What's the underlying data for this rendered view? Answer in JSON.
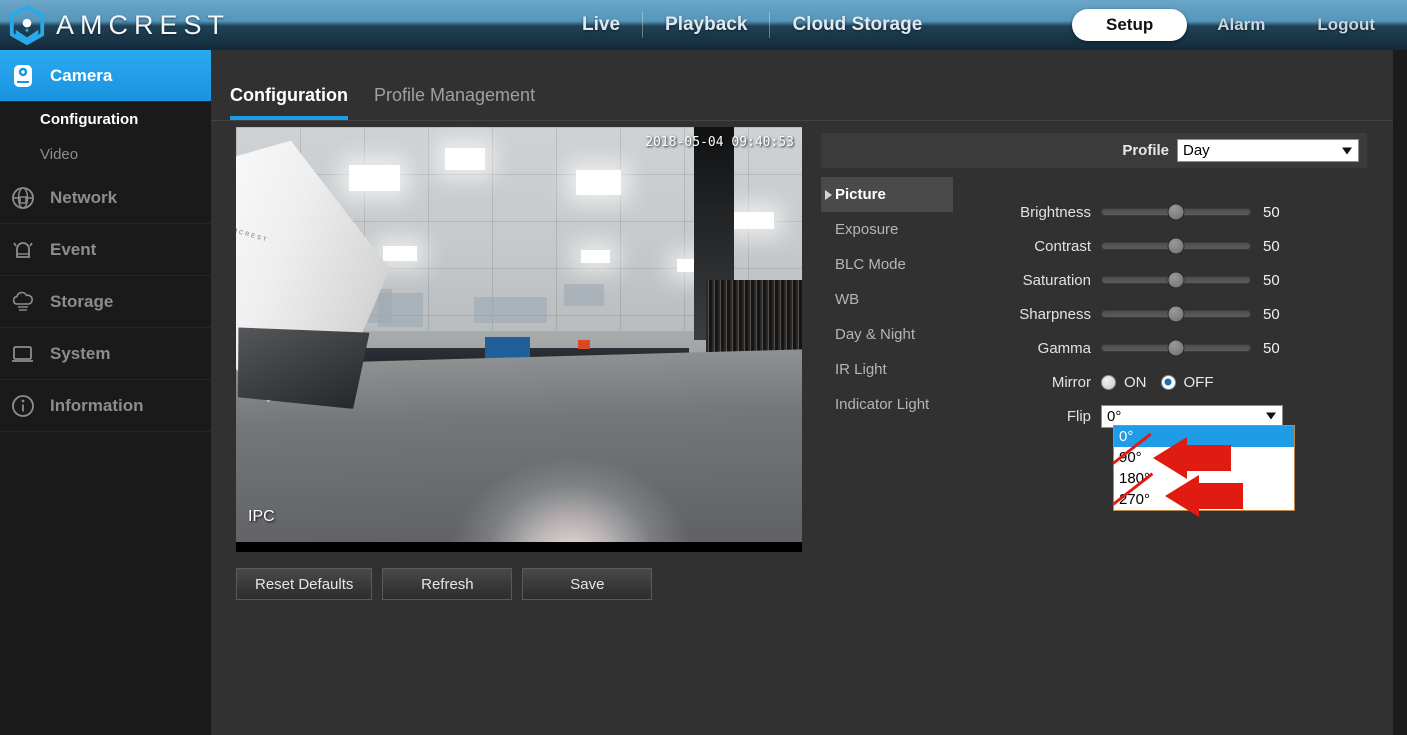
{
  "header": {
    "brand": "AMCREST",
    "brand_icon": "amcrest-hex-logo",
    "nav": [
      {
        "label": "Live"
      },
      {
        "label": "Playback"
      },
      {
        "label": "Cloud Storage"
      }
    ],
    "setup_label": "Setup",
    "alarm_label": "Alarm",
    "logout_label": "Logout",
    "accent_blue": "#1e9ce6"
  },
  "sidebar": {
    "items": [
      {
        "label": "Camera",
        "icon": "camera-icon",
        "active": true
      },
      {
        "label": "Network",
        "icon": "network-globe-icon",
        "active": false
      },
      {
        "label": "Event",
        "icon": "alarm-bell-icon",
        "active": false
      },
      {
        "label": "Storage",
        "icon": "cloud-storage-icon",
        "active": false
      },
      {
        "label": "System",
        "icon": "monitor-icon",
        "active": false
      },
      {
        "label": "Information",
        "icon": "info-circle-icon",
        "active": false
      }
    ],
    "sub_items": [
      {
        "label": "Configuration",
        "current": true
      },
      {
        "label": "Video",
        "current": false
      }
    ]
  },
  "tabs": [
    {
      "label": "Configuration",
      "active": true
    },
    {
      "label": "Profile Management",
      "active": false
    }
  ],
  "video": {
    "timestamp": "2018-05-04 09:40:53",
    "channel_label": "IPC"
  },
  "buttons": [
    {
      "label": "Reset Defaults"
    },
    {
      "label": "Refresh"
    },
    {
      "label": "Save"
    }
  ],
  "profile": {
    "label": "Profile",
    "value": "Day"
  },
  "submenu": [
    {
      "label": "Picture",
      "active": true
    },
    {
      "label": "Exposure",
      "active": false
    },
    {
      "label": "BLC Mode",
      "active": false
    },
    {
      "label": "WB",
      "active": false
    },
    {
      "label": "Day & Night",
      "active": false
    },
    {
      "label": "IR Light",
      "active": false
    },
    {
      "label": "Indicator Light",
      "active": false
    }
  ],
  "sliders": [
    {
      "label": "Brightness",
      "value": "50",
      "percent": 50
    },
    {
      "label": "Contrast",
      "value": "50",
      "percent": 50
    },
    {
      "label": "Saturation",
      "value": "50",
      "percent": 50
    },
    {
      "label": "Sharpness",
      "value": "50",
      "percent": 50
    },
    {
      "label": "Gamma",
      "value": "50",
      "percent": 50
    }
  ],
  "mirror": {
    "label": "Mirror",
    "on_label": "ON",
    "off_label": "OFF",
    "selected": "OFF"
  },
  "flip": {
    "label": "Flip",
    "value": "0°",
    "options": [
      {
        "label": "0°",
        "selected": true,
        "marked": false
      },
      {
        "label": "90°",
        "selected": false,
        "marked": true
      },
      {
        "label": "180°",
        "selected": false,
        "marked": false
      },
      {
        "label": "270°",
        "selected": false,
        "marked": true
      }
    ],
    "annotation_color": "#e01b12"
  }
}
